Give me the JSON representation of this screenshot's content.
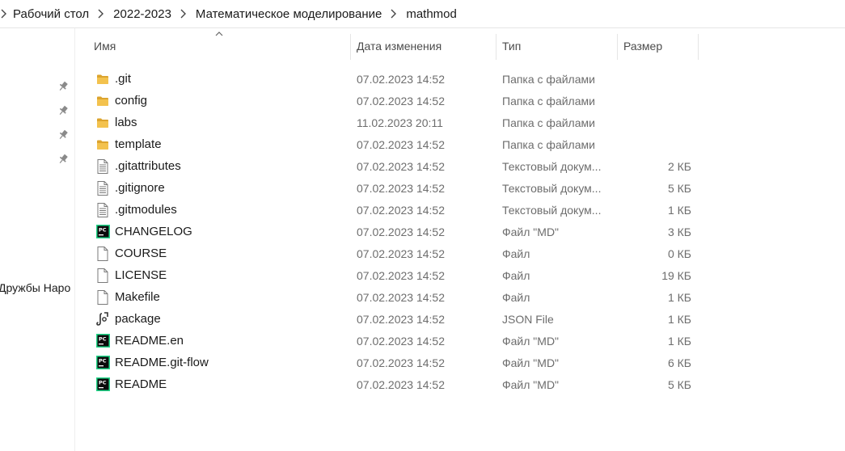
{
  "breadcrumb": {
    "items": [
      "Рабочий стол",
      "2022-2023",
      "Математическое моделирование",
      "mathmod"
    ]
  },
  "nav": {
    "visible_label": "Дружбы Наро"
  },
  "columns": {
    "name": "Имя",
    "date": "Дата изменения",
    "type": "Тип",
    "size": "Размер"
  },
  "files": [
    {
      "name": ".git",
      "date": "07.02.2023 14:52",
      "type": "Папка с файлами",
      "size": "",
      "icon": "folder-icon"
    },
    {
      "name": "config",
      "date": "07.02.2023 14:52",
      "type": "Папка с файлами",
      "size": "",
      "icon": "folder-icon"
    },
    {
      "name": "labs",
      "date": "11.02.2023 20:11",
      "type": "Папка с файлами",
      "size": "",
      "icon": "folder-icon"
    },
    {
      "name": "template",
      "date": "07.02.2023 14:52",
      "type": "Папка с файлами",
      "size": "",
      "icon": "folder-icon"
    },
    {
      "name": ".gitattributes",
      "date": "07.02.2023 14:52",
      "type": "Текстовый докум...",
      "size": "2 КБ",
      "icon": "text-document-icon"
    },
    {
      "name": ".gitignore",
      "date": "07.02.2023 14:52",
      "type": "Текстовый докум...",
      "size": "5 КБ",
      "icon": "text-document-icon"
    },
    {
      "name": ".gitmodules",
      "date": "07.02.2023 14:52",
      "type": "Текстовый докум...",
      "size": "1 КБ",
      "icon": "text-document-icon"
    },
    {
      "name": "CHANGELOG",
      "date": "07.02.2023 14:52",
      "type": "Файл \"MD\"",
      "size": "3 КБ",
      "icon": "pycharm-icon"
    },
    {
      "name": "COURSE",
      "date": "07.02.2023 14:52",
      "type": "Файл",
      "size": "0 КБ",
      "icon": "blank-file-icon"
    },
    {
      "name": "LICENSE",
      "date": "07.02.2023 14:52",
      "type": "Файл",
      "size": "19 КБ",
      "icon": "blank-file-icon"
    },
    {
      "name": "Makefile",
      "date": "07.02.2023 14:52",
      "type": "Файл",
      "size": "1 КБ",
      "icon": "blank-file-icon"
    },
    {
      "name": "package",
      "date": "07.02.2023 14:52",
      "type": "JSON File",
      "size": "1 КБ",
      "icon": "json-file-icon"
    },
    {
      "name": "README.en",
      "date": "07.02.2023 14:52",
      "type": "Файл \"MD\"",
      "size": "1 КБ",
      "icon": "pycharm-icon"
    },
    {
      "name": "README.git-flow",
      "date": "07.02.2023 14:52",
      "type": "Файл \"MD\"",
      "size": "6 КБ",
      "icon": "pycharm-icon"
    },
    {
      "name": "README",
      "date": "07.02.2023 14:52",
      "type": "Файл \"MD\"",
      "size": "5 КБ",
      "icon": "pycharm-icon"
    }
  ],
  "colors": {
    "folder": "#f3c24e",
    "folder_dark": "#dca42e",
    "pycharm_bg": "#0b0b0b",
    "pycharm_accent": "#21d789",
    "text": "#1a1a1a",
    "muted": "#6d6d6d"
  }
}
